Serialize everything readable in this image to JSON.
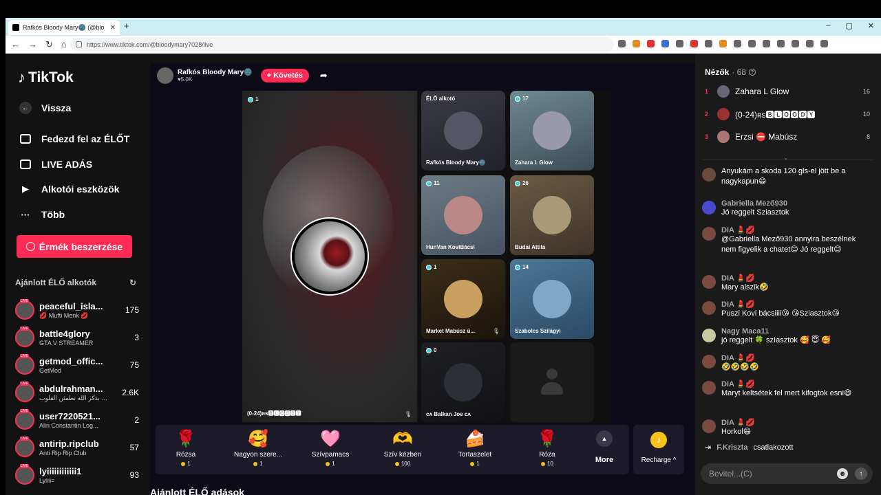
{
  "browser": {
    "tab_title": "Rafkós Bloody Mary🌚 (@blo",
    "new_tab": "+",
    "close": "✕",
    "window_controls": [
      "–",
      "▢",
      "✕"
    ],
    "url": "https://www.tiktok.com/@bloodymary7028/live"
  },
  "sidebar": {
    "logo": "TikTok",
    "back": "Vissza",
    "menu": [
      {
        "label": "Fedezd fel az ÉLŐT",
        "icon": "live-discover-icon"
      },
      {
        "label": "LIVE ADÁS",
        "icon": "camera-icon"
      },
      {
        "label": "Alkotói eszközök",
        "icon": "creator-tools-icon"
      },
      {
        "label": "Több",
        "icon": "more-dots-icon"
      }
    ],
    "coins_button": "Érmék beszerzése",
    "recommended_title": "Ajánlott ÉLŐ alkotók",
    "creators": [
      {
        "name": "peaceful_isla...",
        "sub": "💋 Mufti Menk 💋",
        "count": "175"
      },
      {
        "name": "battle4glory",
        "sub": "GTA V STREAMER",
        "count": "3"
      },
      {
        "name": "getmod_offic...",
        "sub": "GetMod",
        "count": "75"
      },
      {
        "name": "abdulrahman...",
        "sub": "ألا بذكر الله تطمئن القلوب ...",
        "count": "2.6K"
      },
      {
        "name": "user7220521...",
        "sub": "Alin Constantin Log...",
        "count": "2"
      },
      {
        "name": "antirip.ripclub",
        "sub": "Anti Rip Rip Club",
        "count": "57"
      },
      {
        "name": "lyiiiiiiiiiiii1",
        "sub": "Lyiiii=",
        "count": "93"
      }
    ]
  },
  "host": {
    "name": "Rafkós Bloody Mary🌚",
    "likes": "♥5.0K",
    "follow": "+ Követés"
  },
  "stage": {
    "main_viewers": "1",
    "main_name": "(0-24)ʀs🅱🅻🅾🅾🅳🆈",
    "cells": [
      {
        "badge": "ÉLŐ alkotó",
        "name": "Rafkós Bloody Mary🌚"
      },
      {
        "badge": "17",
        "name": "Zahara L Glow"
      },
      {
        "badge": "11",
        "name": "HunVan KoviBácsi"
      },
      {
        "badge": "26",
        "name": "Budai Attila"
      },
      {
        "badge": "1",
        "name": "Market Mabúsz ü..."
      },
      {
        "badge": "14",
        "name": "Szabolcs Szilágyi"
      },
      {
        "badge": "0",
        "name": "ᴄᴀ Balkan Joe ᴄᴀ"
      }
    ]
  },
  "gifts": [
    {
      "icon": "🌹",
      "name": "Rózsa",
      "price": "1"
    },
    {
      "icon": "🥰",
      "name": "Nagyon szere...",
      "price": "1"
    },
    {
      "icon": "🩷",
      "name": "Szívpamacs",
      "price": "1"
    },
    {
      "icon": "🫶",
      "name": "Szív kézben",
      "price": "100"
    },
    {
      "icon": "🍰",
      "name": "Tortaszelet",
      "price": "1"
    },
    {
      "icon": "🌹",
      "name": "Róza",
      "price": "10"
    }
  ],
  "more_label": "More",
  "recharge_label": "Recharge ^",
  "rec_live_title": "Ajánlott ÉLŐ adások",
  "panel": {
    "title": "Nézők",
    "viewer_count": "· 68",
    "top_viewers": [
      {
        "rank": "1",
        "name": "Zahara L Glow",
        "score": "16"
      },
      {
        "rank": "2",
        "name": "(0-24)ʀs🅱🅻🅾🅾🅳🆈",
        "score": "10"
      },
      {
        "rank": "3",
        "name": "Erzsi ⛔ Mabúsz",
        "score": "8"
      }
    ],
    "messages": [
      {
        "user": "",
        "text": "Anyukám a skoda 120 gls-el jött be a nagykapun😄"
      },
      {
        "user": "Gabriella Mező930",
        "text": "Jó reggelt Sziasztok"
      },
      {
        "user": "DIA 💄💋",
        "text": "@Gabriella Mező930 annyira beszélnek nem figyelik a chatet😊 Jó reggelt😊"
      },
      {
        "user": "DIA 💄💋",
        "text": "Mary alszik🤣"
      },
      {
        "user": "DIA 💄💋",
        "text": "Puszi Kovi bácsiiii😘 😘Sziasztok😘"
      },
      {
        "user": "Nagy Maca11",
        "text": "jó reggelt 🍀 szIasztok 🥰 😇 🥰"
      },
      {
        "user": "DIA 💄💋",
        "text": "🤣🤣🤣🤣"
      },
      {
        "user": "DIA 💄💋",
        "text": "Maryt keltsétek fel mert kifogtok esni😄"
      },
      {
        "user": "DIA 💄💋",
        "text": "Horkol😄"
      }
    ],
    "joined_user": "F.Kriszta",
    "joined_text": "csatlakozott",
    "input_placeholder": "Bevitel...(C)"
  }
}
